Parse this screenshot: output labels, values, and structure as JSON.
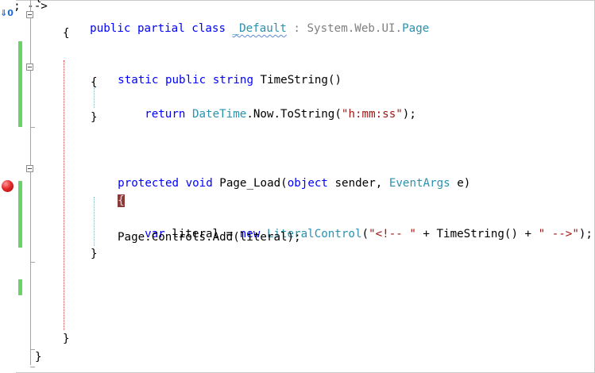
{
  "editor": {
    "lines": {
      "class_decl_kw": "public partial class ",
      "class_name": "_Default",
      "class_sep": " : ",
      "class_base": "System.Web.UI.",
      "class_base_type": "Page",
      "open_brace_class": "{",
      "method1_kw": "static public string ",
      "method1_name": "TimeString()",
      "method1_open": "{",
      "return_kw": "return ",
      "return_type": "DateTime",
      "return_call": ".Now.ToString(",
      "return_str": "\"h:mm:ss\"",
      "return_end": ");",
      "method1_close": "}",
      "method2_kw": "protected void ",
      "method2_name": "Page_Load(",
      "method2_obj": "object",
      "method2_args": " sender, ",
      "method2_evt": "EventArgs",
      "method2_end": " e)",
      "method2_open": "{",
      "var_kw": "var",
      "var_mid": " literal = ",
      "new_kw": "new ",
      "literal_type": "LiteralControl",
      "literal_open": "(",
      "str1": "\"<!-- \"",
      "concat1": " + TimeString() + ",
      "str2": "\" -->\"",
      "literal_end": ");",
      "add_line": "Page.Controls.Add(literal);",
      "method2_close": "}",
      "class_close": "}",
      "ns_close": "}",
      "top_fragment": "{"
    },
    "gutter": {
      "bookmark_icon": "bookmark-arrow-icon",
      "bookmark_text": "⇓0",
      "breakpoint_color": "#e62a2a",
      "change_color": "#6ad26a"
    }
  }
}
